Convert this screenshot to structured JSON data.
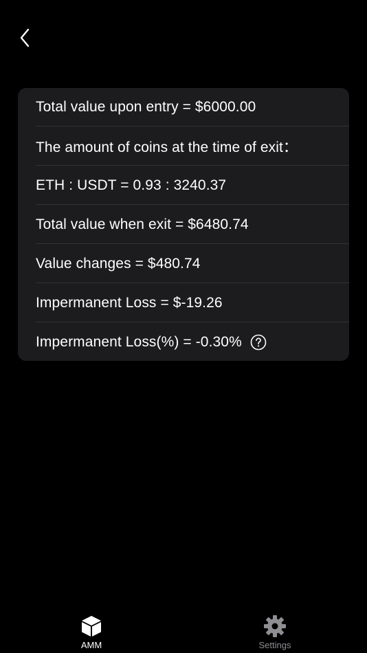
{
  "nav": {
    "back_icon": "chevron-left-icon"
  },
  "results": {
    "rows": [
      {
        "text": "Total value upon entry = $6000.00"
      },
      {
        "text": "The amount of coins at the time of exit："
      },
      {
        "text": "ETH : USDT = 0.93 : 3240.37"
      },
      {
        "text": "Total value when exit = $6480.74"
      },
      {
        "text": "Value changes = $480.74"
      },
      {
        "text": "Impermanent Loss = $-19.26"
      },
      {
        "text": "Impermanent Loss(%) = -0.30%",
        "icon": "question-circle-icon"
      }
    ]
  },
  "tab_bar": {
    "tabs": [
      {
        "label": "AMM",
        "icon": "cube-icon",
        "selected": true
      },
      {
        "label": "Settings",
        "icon": "gear-icon",
        "selected": false
      }
    ]
  },
  "colors": {
    "background": "#000000",
    "card": "#1c1c1e",
    "separator": "#333336",
    "text": "#ffffff",
    "inactive_tab": "#8e8e93"
  }
}
